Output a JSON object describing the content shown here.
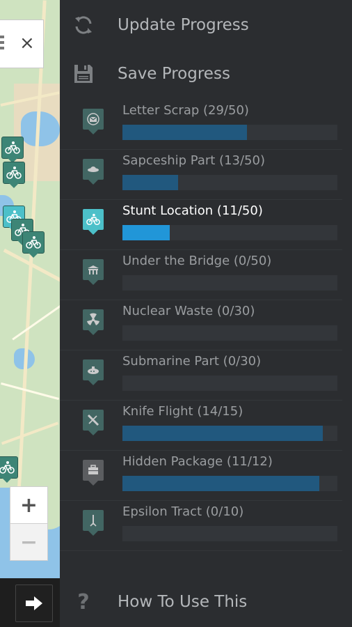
{
  "menu": {
    "update_label": "Update Progress",
    "save_label": "Save Progress",
    "help_label": "How To Use This"
  },
  "map": {
    "close_glyph": "×",
    "zoom_in": "+",
    "zoom_out": "−"
  },
  "collectibles": [
    {
      "name": "Letter Scrap (29/50)",
      "progress": 0.58,
      "icon": "envelope-icon",
      "selected": false
    },
    {
      "name": "Sapceship Part (13/50)",
      "progress": 0.26,
      "icon": "ufo-icon",
      "selected": false
    },
    {
      "name": "Stunt Location (11/50)",
      "progress": 0.22,
      "icon": "bicycle-icon",
      "selected": true
    },
    {
      "name": "Under the Bridge (0/50)",
      "progress": 0,
      "icon": "bridge-icon",
      "selected": false
    },
    {
      "name": "Nuclear Waste (0/30)",
      "progress": 0,
      "icon": "radiation-icon",
      "selected": false
    },
    {
      "name": "Submarine Part (0/30)",
      "progress": 0,
      "icon": "submarine-icon",
      "selected": false
    },
    {
      "name": "Knife Flight (14/15)",
      "progress": 0.933,
      "icon": "plane-icon",
      "selected": false
    },
    {
      "name": "Hidden Package (11/12)",
      "progress": 0.917,
      "icon": "briefcase-icon",
      "selected": false
    },
    {
      "name": "Epsilon Tract (0/10)",
      "progress": 0,
      "icon": "tract-icon",
      "selected": false
    }
  ],
  "colors": {
    "panel_bg": "#2b2d30",
    "bar_fill": "#21587e",
    "bar_active": "#2196d8",
    "pin_active": "#4cc0c9"
  }
}
